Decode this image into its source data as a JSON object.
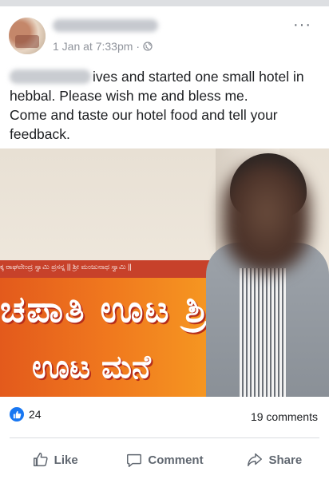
{
  "post": {
    "timestamp": "1 Jan at 7:33pm",
    "separator": "·",
    "text_line1": "ives and started one small hotel in",
    "text_rest": "hebbal. Please  wish me and bless me.\nCome and taste our hotel food and tell your\nfeedback."
  },
  "photo": {
    "banner_line_small": "ಕ್ಕ ರಾಘವೇಂದ್ರ ಸ್ವಾಮಿ ಪ್ರಸನ್ನ || ಶ್ರೀ ಮಂಜುನಾಥ ಸ್ವಾಮಿ ||",
    "banner_big": "ಚಪಾತಿ ಊಟ ಶ್ರೀದೇವ",
    "banner_big2": "ಊಟ ಮನೆ"
  },
  "footer": {
    "like_count": "24",
    "comments": "19 comments",
    "like_label": "Like",
    "comment_label": "Comment",
    "share_label": "Share"
  },
  "colors": {
    "accent": "#1877f2",
    "muted": "#606770",
    "banner": "#f0781e"
  }
}
